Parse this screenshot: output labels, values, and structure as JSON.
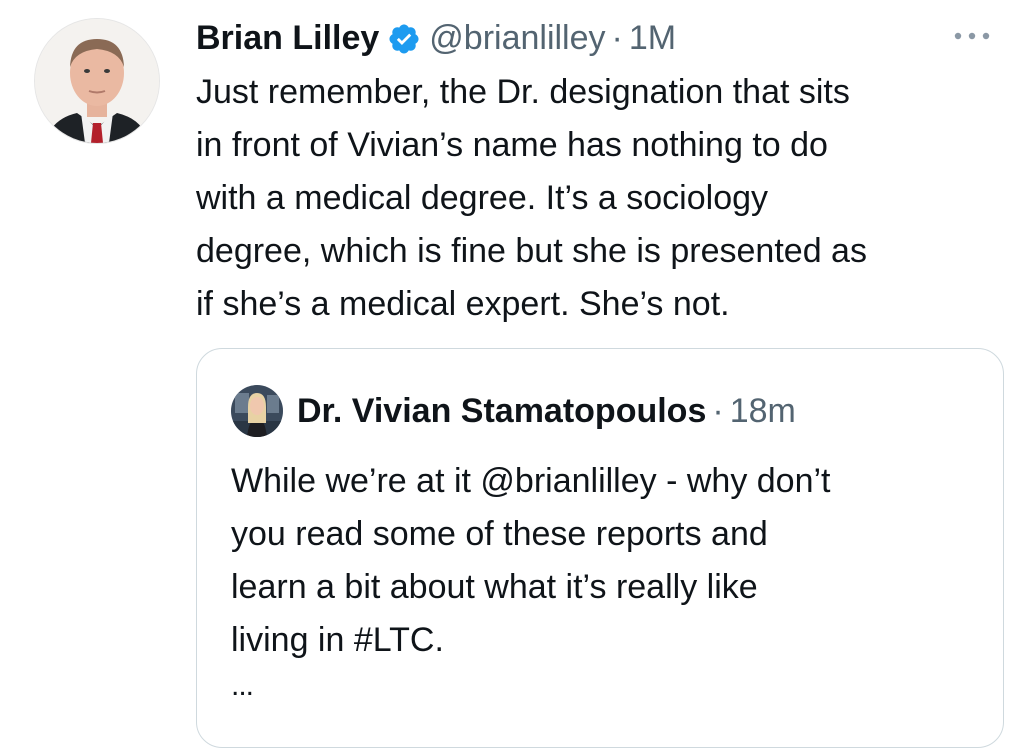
{
  "tweet": {
    "author": {
      "display_name": "Brian Lilley",
      "handle": "@brianlilley",
      "verified": true,
      "avatar_icon": "profile-photo"
    },
    "separator": "·",
    "timestamp": "1M",
    "more_icon": "more-horizontal-icon",
    "text": "Just remember, the Dr. designation that sits\nin front of Vivian’s name has nothing to do\nwith a medical degree. It’s a sociology\ndegree, which is fine but she is presented as\nif she’s a medical expert. She’s not."
  },
  "quoted_tweet": {
    "author": {
      "display_name": "Dr. Vivian Stamatopoulos",
      "avatar_icon": "profile-photo"
    },
    "separator": "·",
    "timestamp": "18m",
    "text": "While we’re at it @brianlilley - why don’t\nyou read some of these reports and\nlearn a bit about what it’s really like\nliving in #LTC.",
    "truncation": "..."
  },
  "colors": {
    "verified_badge": "#1d9bf0",
    "secondary_text": "#536471",
    "border": "#cfd9de",
    "primary_text": "#0f1419"
  }
}
